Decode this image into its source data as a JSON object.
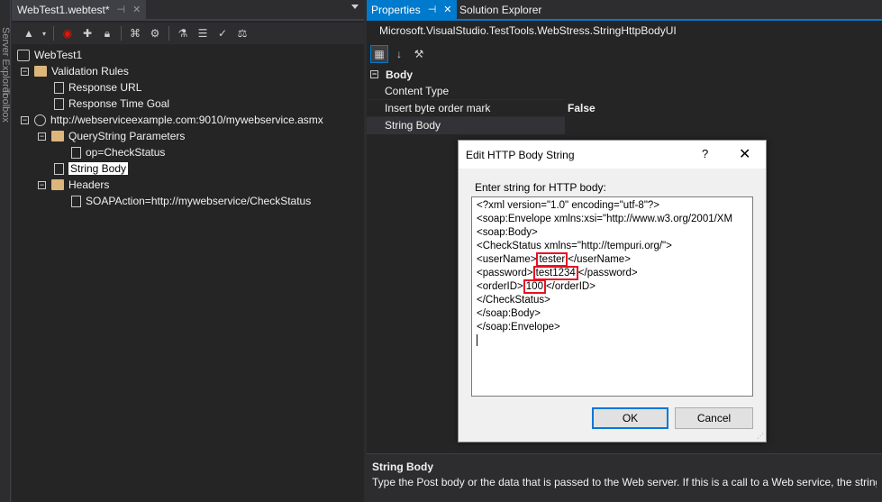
{
  "left_strip": {
    "label_1": "Server Explorer",
    "label_2": "Toolbox"
  },
  "document": {
    "tab_title": "WebTest1.webtest*",
    "pin_glyph": "⊣",
    "close_glyph": "✕"
  },
  "tree": {
    "root": "WebTest1",
    "validation_rules": "Validation Rules",
    "response_url": "Response URL",
    "response_time_goal": "Response Time Goal",
    "request_url": "http://webserviceexample.com:9010/mywebservice.asmx",
    "querystring_parameters": "QueryString Parameters",
    "op_param": "op=CheckStatus",
    "string_body": "String Body",
    "headers": "Headers",
    "soap_action": "SOAPAction=http://mywebservice/CheckStatus"
  },
  "properties": {
    "tab_active": "Properties",
    "tab_other": "Solution Explorer",
    "type_name": "Microsoft.VisualStudio.TestTools.WebStress.StringHttpBodyUI",
    "category": "Body",
    "rows": [
      {
        "name": "Content Type",
        "value": ""
      },
      {
        "name": "Insert byte order mark",
        "value": "False"
      },
      {
        "name": "String Body",
        "value": ""
      }
    ],
    "desc_title": "String Body",
    "desc_text": "Type the Post body or the data that is passed to the Web server. If this is a call to a Web service, the string bo"
  },
  "dialog": {
    "title": "Edit HTTP Body String",
    "help": "?",
    "close": "✕",
    "label": "Enter string for HTTP body:",
    "lines": {
      "l1": "<?xml version=\"1.0\" encoding=\"utf-8\"?>",
      "l2": "<soap:Envelope xmlns:xsi=\"http://www.w3.org/2001/XM",
      "l3": "<soap:Body>",
      "l4": "<CheckStatus xmlns=\"http://tempuri.org/\">",
      "l5_pre": "<userName>",
      "l5_val": "tester",
      "l5_post": "</userName>",
      "l6_pre": "<password>",
      "l6_val": "test1234",
      "l6_post": "</password>",
      "l7_pre": "<orderID>",
      "l7_val": "100",
      "l7_post": "</orderID>",
      "l8": "</CheckStatus>",
      "l9": "</soap:Body>",
      "l10": "</soap:Envelope>"
    },
    "ok_label": "OK",
    "cancel_label": "Cancel"
  },
  "colors": {
    "ide_background": "#2d2d30",
    "panel_background": "#252526",
    "accent": "#007acc",
    "highlight_box": "#e81123"
  }
}
